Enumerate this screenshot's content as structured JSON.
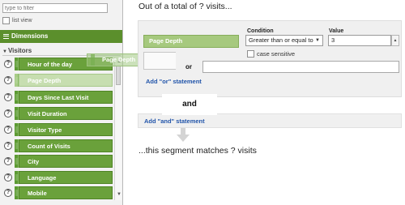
{
  "left_panel": {
    "filter_placeholder": "type to filter",
    "list_view_label": "list view",
    "dimensions_header": "Dimensions",
    "group_label": "Visitors",
    "dimension_items": [
      "Hour of the day",
      "Page Depth",
      "Days Since Last Visit",
      "Visit Duration",
      "Visitor Type",
      "Count of Visits",
      "City",
      "Language",
      "Mobile"
    ],
    "selected_item": "Page Depth",
    "drag_ghost_label": "Page Depth"
  },
  "segment": {
    "title": "Out of a total of ? visits...",
    "condition_label": "Condition",
    "value_label": "Value",
    "dimension_pill": "Page Depth",
    "condition_selected": "Greater than or equal to",
    "value": "3",
    "case_sensitive_label": "case sensitive",
    "or_label": "or",
    "add_or_label": "Add \"or\" statement",
    "and_label": "and",
    "add_and_label": "Add \"and\" statement",
    "footer": "...this segment matches ? visits"
  },
  "colors": {
    "accent_green": "#5b8f2c",
    "pill_green": "#6aa13b",
    "link_blue": "#2255aa"
  }
}
